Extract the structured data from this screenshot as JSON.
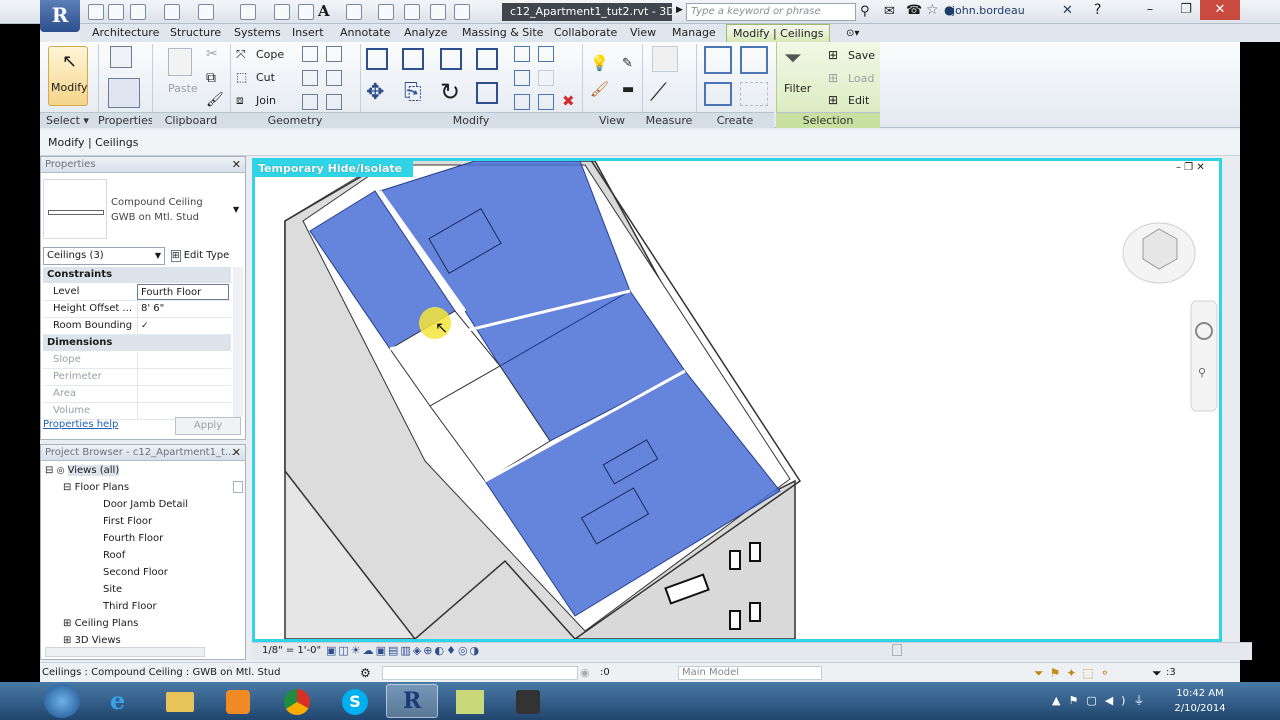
{
  "title_bar": {
    "document_title": "c12_Apartment1_tut2.rvt - 3D...",
    "search_placeholder": "Type a keyword or phrase",
    "user": "john.bordeau"
  },
  "ribbon_tabs": [
    "Architecture",
    "Structure",
    "Systems",
    "Insert",
    "Annotate",
    "Analyze",
    "Massing & Site",
    "Collaborate",
    "View",
    "Manage"
  ],
  "active_tab": "Modify | Ceilings",
  "ribbon": {
    "modify_label": "Modify",
    "properties_label": "Properties",
    "paste_label": "Paste",
    "cope_label": "Cope",
    "cut_label": "Cut",
    "join_label": "Join",
    "filter_label": "Filter",
    "save_label": "Save",
    "load_label": "Load",
    "edit_label": "Edit",
    "panels": {
      "select": "Select",
      "properties": "Properties",
      "clipboard": "Clipboard",
      "geometry": "Geometry",
      "modify": "Modify",
      "view": "View",
      "measure": "Measure",
      "create": "Create",
      "selection": "Selection"
    }
  },
  "options_bar": "Modify | Ceilings",
  "properties_panel": {
    "header": "Properties",
    "type_name_1": "Compound Ceiling",
    "type_name_2": "GWB on Mtl. Stud",
    "selector": "Ceilings (3)",
    "edit_type": "Edit Type",
    "groups": {
      "constraints": "Constraints",
      "dimensions": "Dimensions"
    },
    "rows": {
      "level_k": "Level",
      "level_v": "Fourth Floor",
      "height_k": "Height Offset ...",
      "height_v": "8'  6\"",
      "room_k": "Room Bounding",
      "room_v": "✓",
      "slope_k": "Slope",
      "perimeter_k": "Perimeter",
      "area_k": "Area",
      "volume_k": "Volume"
    },
    "help": "Properties help",
    "apply": "Apply"
  },
  "project_browser": {
    "header": "Project Browser - c12_Apartment1_t...",
    "views": "Views (all)",
    "floor_plans": "Floor Plans",
    "plans": [
      "Door Jamb Detail",
      "First Floor",
      "Fourth Floor",
      "Roof",
      "Second Floor",
      "Site",
      "Third Floor"
    ],
    "ceiling_plans": "Ceiling Plans",
    "views_3d": "3D Views"
  },
  "viewport": {
    "mode_label": "Temporary Hide/Isolate",
    "highlight_color": "#4a6fd6",
    "frame_color": "#2fd5e6"
  },
  "view_bar": {
    "scale": "1/8\" = 1'-0\""
  },
  "status_bar": {
    "text": "Ceilings : Compound Ceiling : GWB on Mtl. Stud",
    "zero": ":0",
    "model": "Main Model",
    "filter_count": ":3"
  },
  "taskbar": {
    "time": "10:42 AM",
    "date": "2/10/2014"
  }
}
